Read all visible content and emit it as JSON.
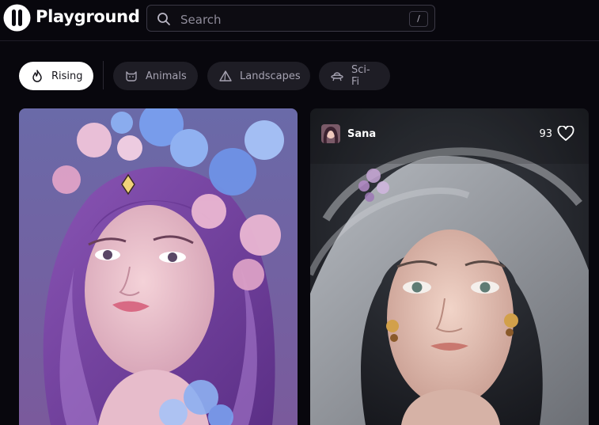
{
  "header": {
    "brand": "Playground",
    "search": {
      "placeholder": "Search",
      "shortcut": "/"
    }
  },
  "filters": [
    {
      "label": "Rising",
      "icon": "flame-icon",
      "active": true
    },
    {
      "label": "Animals",
      "icon": "cat-icon",
      "active": false
    },
    {
      "label": "Landscapes",
      "icon": "mountain-icon",
      "active": false
    },
    {
      "label": "Sci-Fi",
      "icon": "ufo-icon",
      "active": false
    }
  ],
  "feed": [
    {
      "image": "purple-haired woman with blue flower crown"
    },
    {
      "user": "Sana",
      "likes": "93",
      "image": "silver-haired woman portrait"
    }
  ],
  "colors": {
    "background": "#08070d",
    "chip": "#1e1d25",
    "chip_active": "#ffffff"
  }
}
